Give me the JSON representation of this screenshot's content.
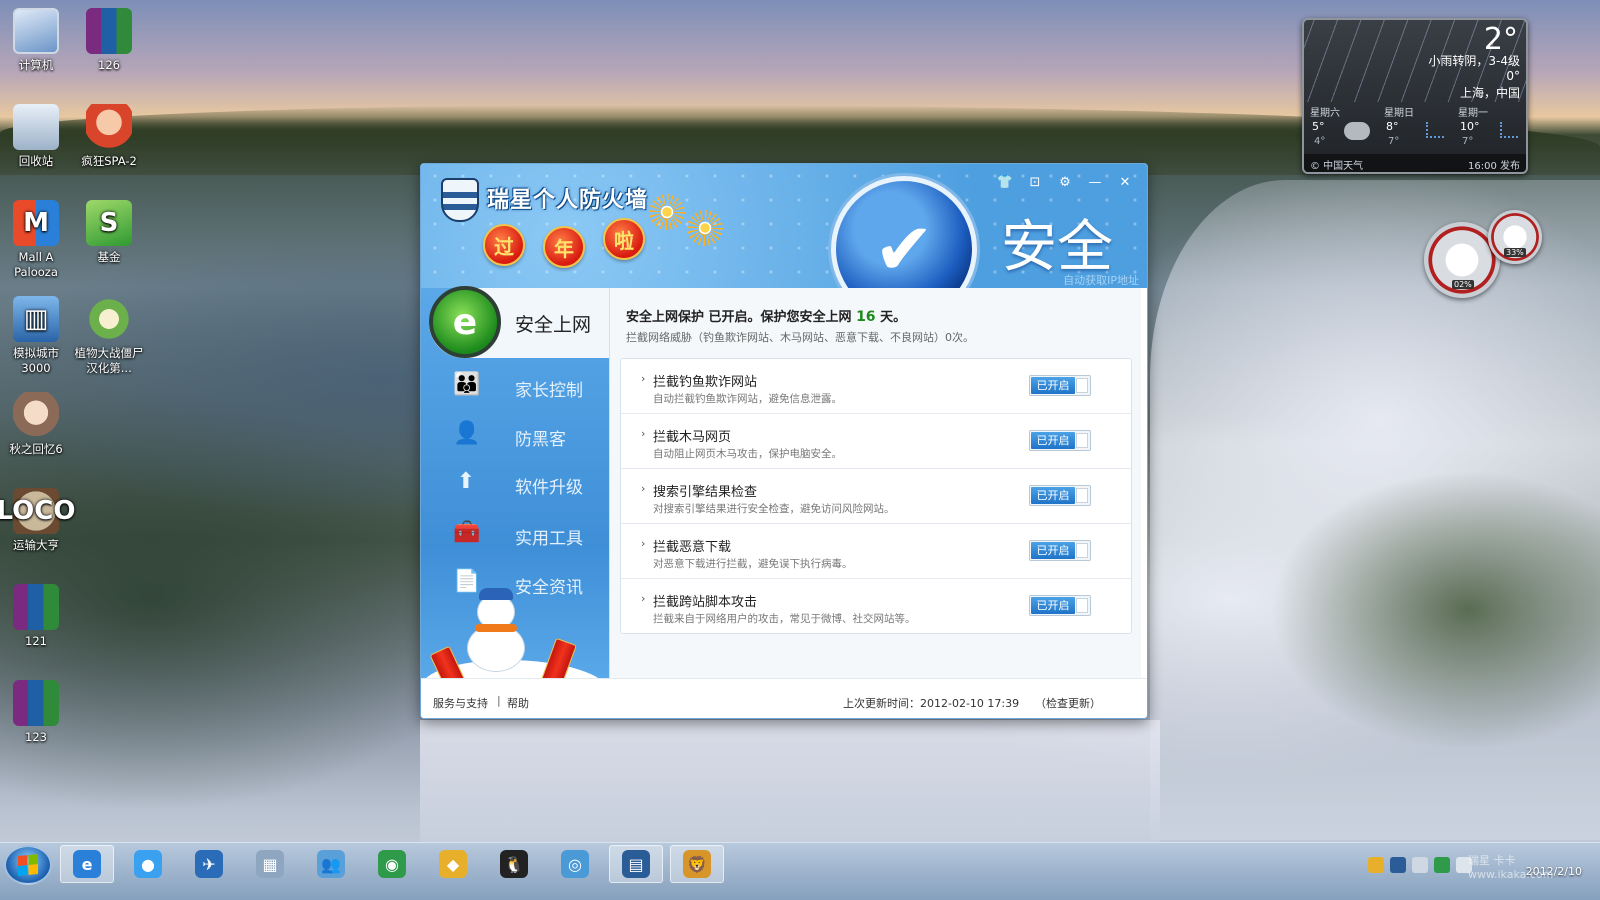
{
  "desktop": {
    "icons": [
      {
        "label": "计算机",
        "icon": "computer-icon"
      },
      {
        "label": "126",
        "icon": "winrar-archive-icon"
      },
      {
        "label": "回收站",
        "icon": "recycle-bin-icon"
      },
      {
        "label": "疯狂SPA-2",
        "icon": "game-character-icon"
      },
      {
        "label": "Mall A Palooza",
        "icon": "mall-game-icon"
      },
      {
        "label": "基金",
        "icon": "spreadsheet-icon"
      },
      {
        "label": "模拟城市 3000",
        "icon": "simcity-icon"
      },
      {
        "label": "植物大战僵尸 汉化第...",
        "icon": "plants-game-icon"
      },
      {
        "label": "秋之回忆6",
        "icon": "anime-game-icon"
      },
      {
        "label": "运输大亨",
        "icon": "transport-tycoon-icon"
      },
      {
        "label": "121",
        "icon": "winrar-archive-icon"
      },
      {
        "label": "123",
        "icon": "winrar-archive-icon"
      }
    ]
  },
  "weather": {
    "temp": "2°",
    "condition": "小雨转阴，3-4级",
    "condition2": "0°",
    "location": "上海，中国",
    "days": [
      {
        "name": "星期六",
        "hi": "5°",
        "lo": "4°"
      },
      {
        "name": "星期日",
        "hi": "8°",
        "lo": "7°"
      },
      {
        "name": "星期一",
        "hi": "10°",
        "lo": "7°"
      }
    ],
    "source": "© 中国天气",
    "published": "16:00 发布"
  },
  "meters": {
    "cpu": "02%",
    "mem": "33%"
  },
  "window": {
    "app_title": "瑞星个人防火墙",
    "festive": [
      "过",
      "年",
      "啦"
    ],
    "status": "安全",
    "status_sub": "自动获取IP地址",
    "badge_glyph": "e",
    "check_glyph": "✔",
    "controls": {
      "skin": "👕",
      "mini": "⊡",
      "settings": "⚙",
      "minimize": "—",
      "close": "✕"
    },
    "sidebar": {
      "active": "安全上网",
      "items": [
        {
          "label": "家长控制",
          "icon": "parents-icon",
          "glyph": "👪"
        },
        {
          "label": "防黑客",
          "icon": "hacker-icon",
          "glyph": "👤"
        },
        {
          "label": "软件升级",
          "icon": "upgrade-arrow-icon",
          "glyph": "⬆"
        },
        {
          "label": "实用工具",
          "icon": "toolbox-icon",
          "glyph": "🧰"
        },
        {
          "label": "安全资讯",
          "icon": "news-document-icon",
          "glyph": "📄"
        }
      ]
    },
    "main": {
      "title_prefix": "安全上网保护 已开启。保护您安全上网 ",
      "days": "16",
      "title_suffix": " 天。",
      "desc": "拦截网络威胁（钓鱼欺诈网站、木马网站、恶意下载、不良网站）0次。",
      "items": [
        {
          "title": "拦截钓鱼欺诈网站",
          "desc": "自动拦截钓鱼欺诈网站，避免信息泄露。",
          "toggle": "已开启"
        },
        {
          "title": "拦截木马网页",
          "desc": "自动阻止网页木马攻击，保护电脑安全。",
          "toggle": "已开启"
        },
        {
          "title": "搜索引擎结果检查",
          "desc": "对搜索引擎结果进行安全检查，避免访问风险网站。",
          "toggle": "已开启"
        },
        {
          "title": "拦截恶意下载",
          "desc": "对恶意下载进行拦截，避免误下执行病毒。",
          "toggle": "已开启"
        },
        {
          "title": "拦截跨站脚本攻击",
          "desc": "拦截来自于网络用户的攻击，常见于微博、社交网站等。",
          "toggle": "已开启"
        }
      ],
      "arrow": "›"
    },
    "footer": {
      "support": "服务与支持",
      "sep": "|",
      "help": "帮助",
      "update": "上次更新时间：2012-02-10 17:39",
      "check": "（检查更新）"
    }
  },
  "taskbar": {
    "apps": [
      {
        "name": "internet-explorer-icon",
        "glyph": "e",
        "color": "#2a7fd8"
      },
      {
        "name": "qq-browser-icon",
        "glyph": "●",
        "color": "#3aa0f0"
      },
      {
        "name": "bird-app-icon",
        "glyph": "✈",
        "color": "#2b6cb8"
      },
      {
        "name": "calculator-icon",
        "glyph": "▦",
        "color": "#8fa6c0"
      },
      {
        "name": "users-icon",
        "glyph": "👥",
        "color": "#5aa0d8"
      },
      {
        "name": "globe-download-icon",
        "glyph": "◉",
        "color": "#2f9a4a"
      },
      {
        "name": "shield-app-icon",
        "glyph": "◆",
        "color": "#e8b02a"
      },
      {
        "name": "qq-penguin-icon",
        "glyph": "🐧",
        "color": "#222222"
      },
      {
        "name": "media-player-icon",
        "glyph": "◎",
        "color": "#4a9ad8"
      },
      {
        "name": "rising-firewall-icon",
        "glyph": "▤",
        "color": "#2a5c98"
      },
      {
        "name": "lion-antivirus-icon",
        "glyph": "🦁",
        "color": "#d8962a"
      }
    ],
    "clock_date": "2012/2/10",
    "watermark": "瑞星 卡卡 www.ikaka.com"
  }
}
